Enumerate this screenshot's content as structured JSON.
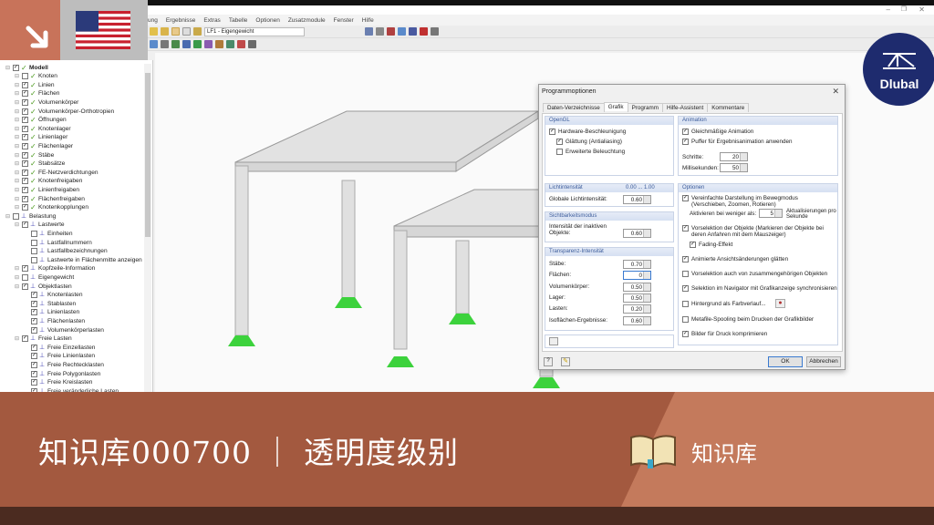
{
  "menu": [
    "ung",
    "Ergebnisse",
    "Extras",
    "Tabelle",
    "Optionen",
    "Zusatzmodule",
    "Fenster",
    "Hilfe"
  ],
  "toolbar": {
    "loadcase": "LF1 - Eigengewicht"
  },
  "tree": [
    {
      "label": "Modell",
      "level": 0,
      "checked": true,
      "icon": "model",
      "bold": true
    },
    {
      "label": "Knoten",
      "level": 1,
      "checked": false,
      "icon": "model"
    },
    {
      "label": "Linien",
      "level": 1,
      "checked": true,
      "icon": "model"
    },
    {
      "label": "Flächen",
      "level": 1,
      "checked": true,
      "icon": "model"
    },
    {
      "label": "Volumenkörper",
      "level": 1,
      "checked": true,
      "icon": "model"
    },
    {
      "label": "Volumenkörper-Orthotropien",
      "level": 1,
      "checked": true,
      "icon": "model"
    },
    {
      "label": "Öffnungen",
      "level": 1,
      "checked": true,
      "icon": "model"
    },
    {
      "label": "Knotenlager",
      "level": 1,
      "checked": true,
      "icon": "model"
    },
    {
      "label": "Linienlager",
      "level": 1,
      "checked": true,
      "icon": "model"
    },
    {
      "label": "Flächenlager",
      "level": 1,
      "checked": true,
      "icon": "model"
    },
    {
      "label": "Stäbe",
      "level": 1,
      "checked": true,
      "icon": "model"
    },
    {
      "label": "Stabsätze",
      "level": 1,
      "checked": true,
      "icon": "model"
    },
    {
      "label": "FE-Netzverdichtungen",
      "level": 1,
      "checked": true,
      "icon": "model"
    },
    {
      "label": "Knotenfreigaben",
      "level": 1,
      "checked": true,
      "icon": "model"
    },
    {
      "label": "Linienfreigaben",
      "level": 1,
      "checked": true,
      "icon": "model"
    },
    {
      "label": "Flächenfreigaben",
      "level": 1,
      "checked": true,
      "icon": "model"
    },
    {
      "label": "Knotenkopplungen",
      "level": 1,
      "checked": true,
      "icon": "model"
    },
    {
      "label": "Belastung",
      "level": 0,
      "checked": false,
      "icon": "load"
    },
    {
      "label": "Lastwerte",
      "level": 1,
      "checked": true,
      "icon": "load"
    },
    {
      "label": "Einheiten",
      "level": 2,
      "checked": false,
      "icon": "load"
    },
    {
      "label": "Lastfallnummern",
      "level": 2,
      "checked": false,
      "icon": "load"
    },
    {
      "label": "Lastfallbezeichnungen",
      "level": 2,
      "checked": false,
      "icon": "load"
    },
    {
      "label": "Lastwerte in Flächenmitte anzeigen",
      "level": 2,
      "checked": false,
      "icon": "load"
    },
    {
      "label": "Kopfzeile-Information",
      "level": 1,
      "checked": true,
      "icon": "load"
    },
    {
      "label": "Eigengewicht",
      "level": 1,
      "checked": false,
      "icon": "load"
    },
    {
      "label": "Objektlasten",
      "level": 1,
      "checked": true,
      "icon": "load"
    },
    {
      "label": "Knotenlasten",
      "level": 2,
      "checked": true,
      "icon": "load"
    },
    {
      "label": "Stablasten",
      "level": 2,
      "checked": true,
      "icon": "load"
    },
    {
      "label": "Linienlasten",
      "level": 2,
      "checked": true,
      "icon": "load"
    },
    {
      "label": "Flächenlasten",
      "level": 2,
      "checked": true,
      "icon": "load"
    },
    {
      "label": "Volumenkörperlasten",
      "level": 2,
      "checked": true,
      "icon": "load"
    },
    {
      "label": "Freie Lasten",
      "level": 1,
      "checked": true,
      "icon": "load"
    },
    {
      "label": "Freie Einzellasten",
      "level": 2,
      "checked": true,
      "icon": "load"
    },
    {
      "label": "Freie Linienlasten",
      "level": 2,
      "checked": true,
      "icon": "load"
    },
    {
      "label": "Freie Rechtecklasten",
      "level": 2,
      "checked": true,
      "icon": "load"
    },
    {
      "label": "Freie Polygonlasten",
      "level": 2,
      "checked": true,
      "icon": "load"
    },
    {
      "label": "Freie Kreislasten",
      "level": 2,
      "checked": true,
      "icon": "load"
    },
    {
      "label": "Freie veränderliche Lasten",
      "level": 2,
      "checked": true,
      "icon": "load"
    }
  ],
  "dialog": {
    "title": "Programmoptionen",
    "tabs": [
      "Daten-Verzeichnisse",
      "Grafik",
      "Programm",
      "Hilfe-Assistent",
      "Kommentare"
    ],
    "active_tab": "Grafik",
    "opengl": {
      "header": "OpenGL",
      "hw": "Hardware-Beschleunigung",
      "aa": "Glättung (Antialiasing)",
      "light": "Erweiterte Beleuchtung"
    },
    "licht": {
      "header": "Lichtintensität",
      "range": "0.00 ... 1.00",
      "label": "Globale Lichtintensität:",
      "value": "0.60"
    },
    "sicht": {
      "header": "Sichtbarkeitsmodus",
      "label": "Intensität der inaktiven Objekte:",
      "value": "0.60"
    },
    "transp": {
      "header": "Transparenz-Intensität",
      "rows": [
        {
          "label": "Stäbe:",
          "value": "0.70"
        },
        {
          "label": "Flächen:",
          "value": "0"
        },
        {
          "label": "Volumenkörper:",
          "value": "0.50"
        },
        {
          "label": "Lager:",
          "value": "0.50"
        },
        {
          "label": "Lasten:",
          "value": "0.20"
        },
        {
          "label": "Isoflächen-Ergebnisse:",
          "value": "0.60"
        }
      ]
    },
    "anim": {
      "header": "Animation",
      "smooth": "Gleichmäßige Animation",
      "buffer": "Puffer für Ergebnisanimation anwenden",
      "steps_label": "Schritte:",
      "steps": "20",
      "ms_label": "Millisekunden:",
      "ms": "50"
    },
    "opt": {
      "header": "Optionen",
      "simpl": "Vereinfachte Darstellung im Bewegmodus (Verschieben, Zoomen, Rotieren)",
      "act_label": "Aktivieren bei weniger als:",
      "act_value": "5",
      "act_unit": "Aktualisierungen pro Sekunde",
      "presel": "Vorselektion der Objekte (Markieren der Objekte bei deren Anfahren mit dem Mauszeiger)",
      "fading": "Fading-Effekt",
      "animviews": "Animierte Ansichtsänderungen glätten",
      "presel2": "Vorselektion auch von zusammengehörigen Objekten",
      "sync": "Selektion im Navigator mit Grafikanzeige synchronisieren",
      "gradient": "Hintergrund als Farbverlauf...",
      "metafile": "Metafile-Spooling beim Drucken der Grafikbilder",
      "compress": "Bilder für Druck komprimieren"
    },
    "ok": "OK",
    "cancel": "Abbrechen"
  },
  "banner": {
    "title": "知识库000700 ｜ 透明度级别",
    "kb": "知识库"
  },
  "logo": {
    "text": "Dlubal"
  },
  "colors": {
    "orange": "#c8735a",
    "banner": "#a3593f",
    "navy": "#1e2b6e"
  }
}
